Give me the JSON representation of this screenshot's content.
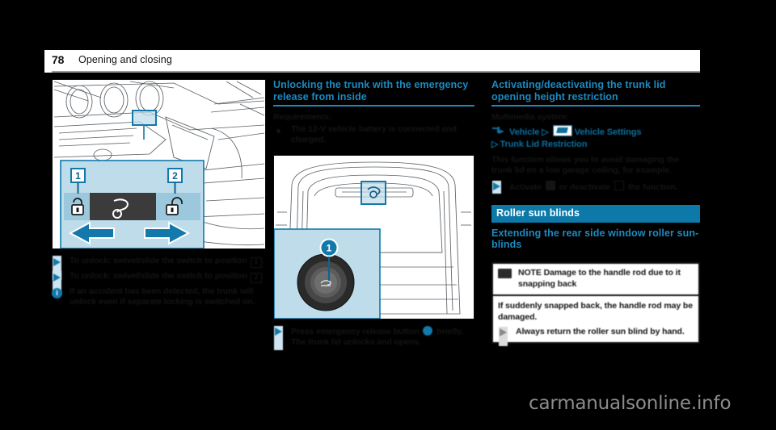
{
  "page": {
    "number": "78",
    "running_title": "Opening and closing"
  },
  "column_left": {
    "figure": {
      "name": "dashboard-lock-switch-illustration",
      "callouts": [
        "1",
        "2"
      ],
      "switch_icons": [
        "locked-padlock",
        "trunk-open-symbol",
        "unlocked-padlock"
      ],
      "arrows": [
        "left-arrow",
        "right-arrow"
      ]
    },
    "steps": [
      {
        "text_before": "To unlock: swivel/slide the switch to position ",
        "glyph": "1",
        "text_after": "."
      },
      {
        "text_before": "To unlock: swivel/slide the switch to position ",
        "glyph": "2",
        "text_after": "."
      }
    ],
    "note": "If an accident has been detected, the trunk will unlock even if separate locking is switched on."
  },
  "column_middle": {
    "heading": "Unlocking the trunk with the emergency release from inside",
    "requirements_label": "Requirements:",
    "requirements": [
      "The 12-V vehicle battery is connected and charged."
    ],
    "figure": {
      "name": "trunk-interior-emergency-release-illustration",
      "callouts": [
        "1"
      ],
      "detail_icon": "emergency-release-button"
    },
    "step": {
      "text_before": "Press emergency release button ",
      "callout": "1",
      "text_after": " briefly."
    },
    "step_result": "The trunk lid unlocks and opens."
  },
  "column_right": {
    "heading": "Activating/deactivating the trunk lid opening height restriction",
    "multimedia_label": "Multimedia system:",
    "path": {
      "arrow_icon": "home-arrow-icon",
      "item1": "Vehicle",
      "chevron": "▷",
      "settings_icon": "vehicle-settings-icon",
      "item2": "Vehicle Settings",
      "item3": "Trunk Lid Restriction"
    },
    "description": "This function allows you to avoid damaging the trunk lid on a low garage ceiling, for example.",
    "step": {
      "text_before": "Activate ",
      "checkbox_on": "☑",
      "text_middle": " or deactivate ",
      "checkbox_off": "☐",
      "text_after": " the function."
    },
    "section_banner": "Roller sun blinds",
    "subheading": "Extending the rear side window roller sun-blinds",
    "warning": {
      "icon": "note-icon",
      "title_label": "NOTE",
      "title": " Damage to the handle rod due to it snapping back",
      "body": "If suddenly snapped back, the handle rod may be damaged.",
      "action": "Always return the roller sun blind by hand."
    }
  },
  "watermark": "carmanualsonline.info",
  "colors": {
    "banner_blue": "#0d79a9",
    "heading_blue": "#1c8ac0",
    "marker_blue": "#1279aa",
    "rail_blue": "#cfe6f2",
    "figure_panel_blue": "#bfdcea",
    "text_dark": "#141414"
  }
}
